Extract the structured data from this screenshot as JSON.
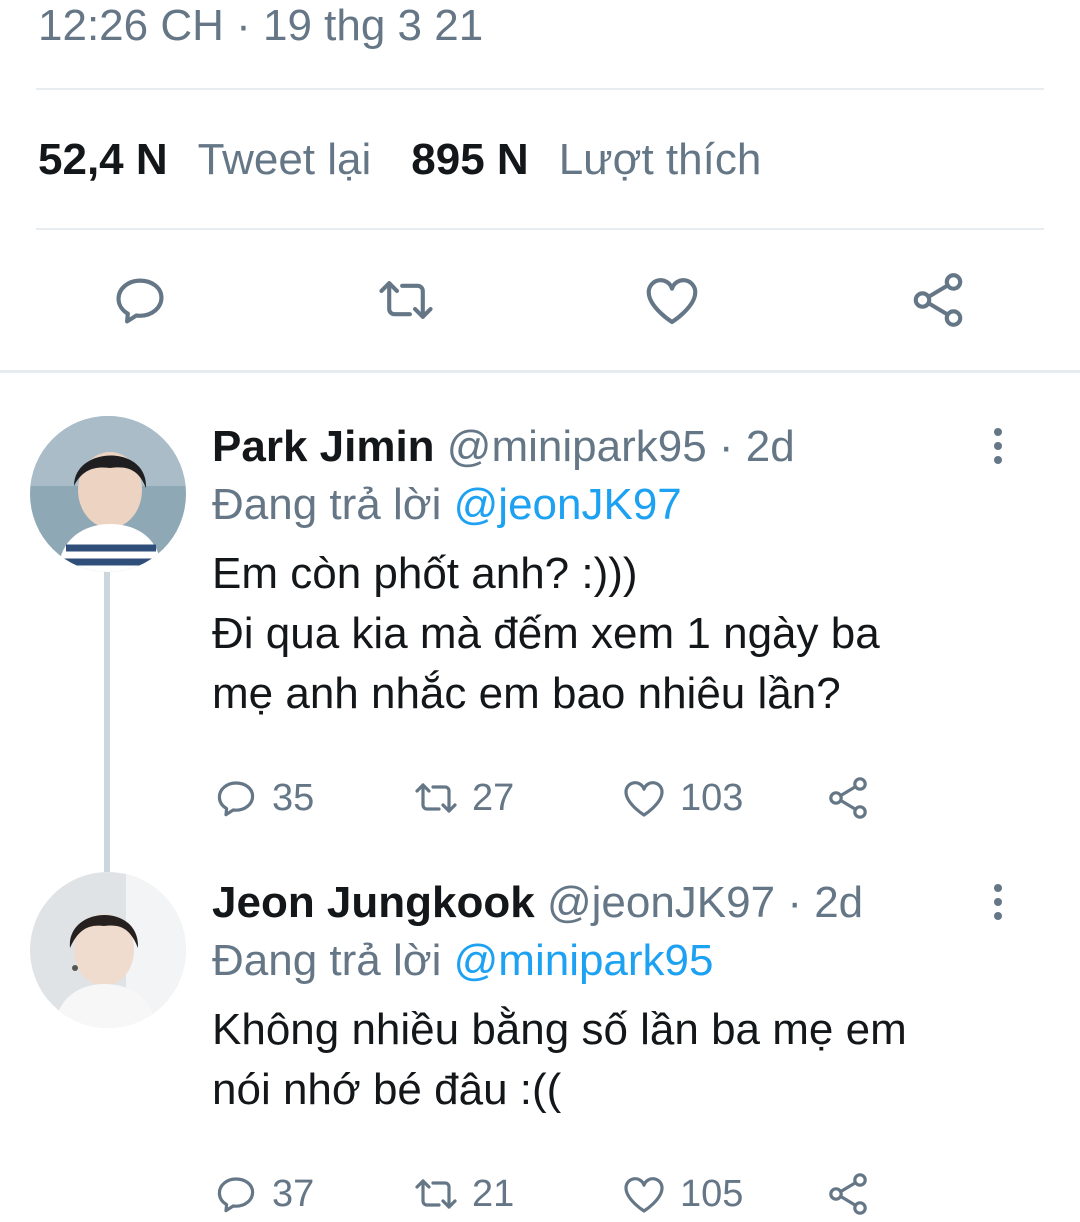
{
  "tweet": {
    "timestamp": "12:26 CH · 19 thg 3 21",
    "retweets_count": "52,4 N",
    "retweets_label": "Tweet lại",
    "likes_count": "895 N",
    "likes_label": "Lượt thích"
  },
  "replies": [
    {
      "name": "Park Jimin",
      "handle": "@minipark95 · 2d",
      "replying_prefix": "Đang trả lời",
      "replying_to": "@jeonJK97",
      "text_lines": [
        "Em còn phốt anh? :)))",
        "Đi qua kia mà đếm xem 1 ngày ba",
        "mẹ anh nhắc em bao nhiêu lần?"
      ],
      "reply_count": "35",
      "retweet_count": "27",
      "like_count": "103"
    },
    {
      "name": "Jeon Jungkook",
      "handle": "@jeonJK97 · 2d",
      "replying_prefix": "Đang trả lời",
      "replying_to": "@minipark95",
      "text_lines": [
        "Không nhiều bằng số lần ba mẹ em",
        "nói nhớ bé đâu :(("
      ],
      "reply_count": "37",
      "retweet_count": "21",
      "like_count": "105"
    }
  ],
  "icons": {
    "reply": "reply-icon",
    "retweet": "retweet-icon",
    "like": "heart-icon",
    "share": "share-icon",
    "more": "more-vertical-icon"
  },
  "colors": {
    "accent": "#1da1f2",
    "muted": "#657786",
    "text": "#14171a",
    "divider": "#e6ecf0"
  }
}
